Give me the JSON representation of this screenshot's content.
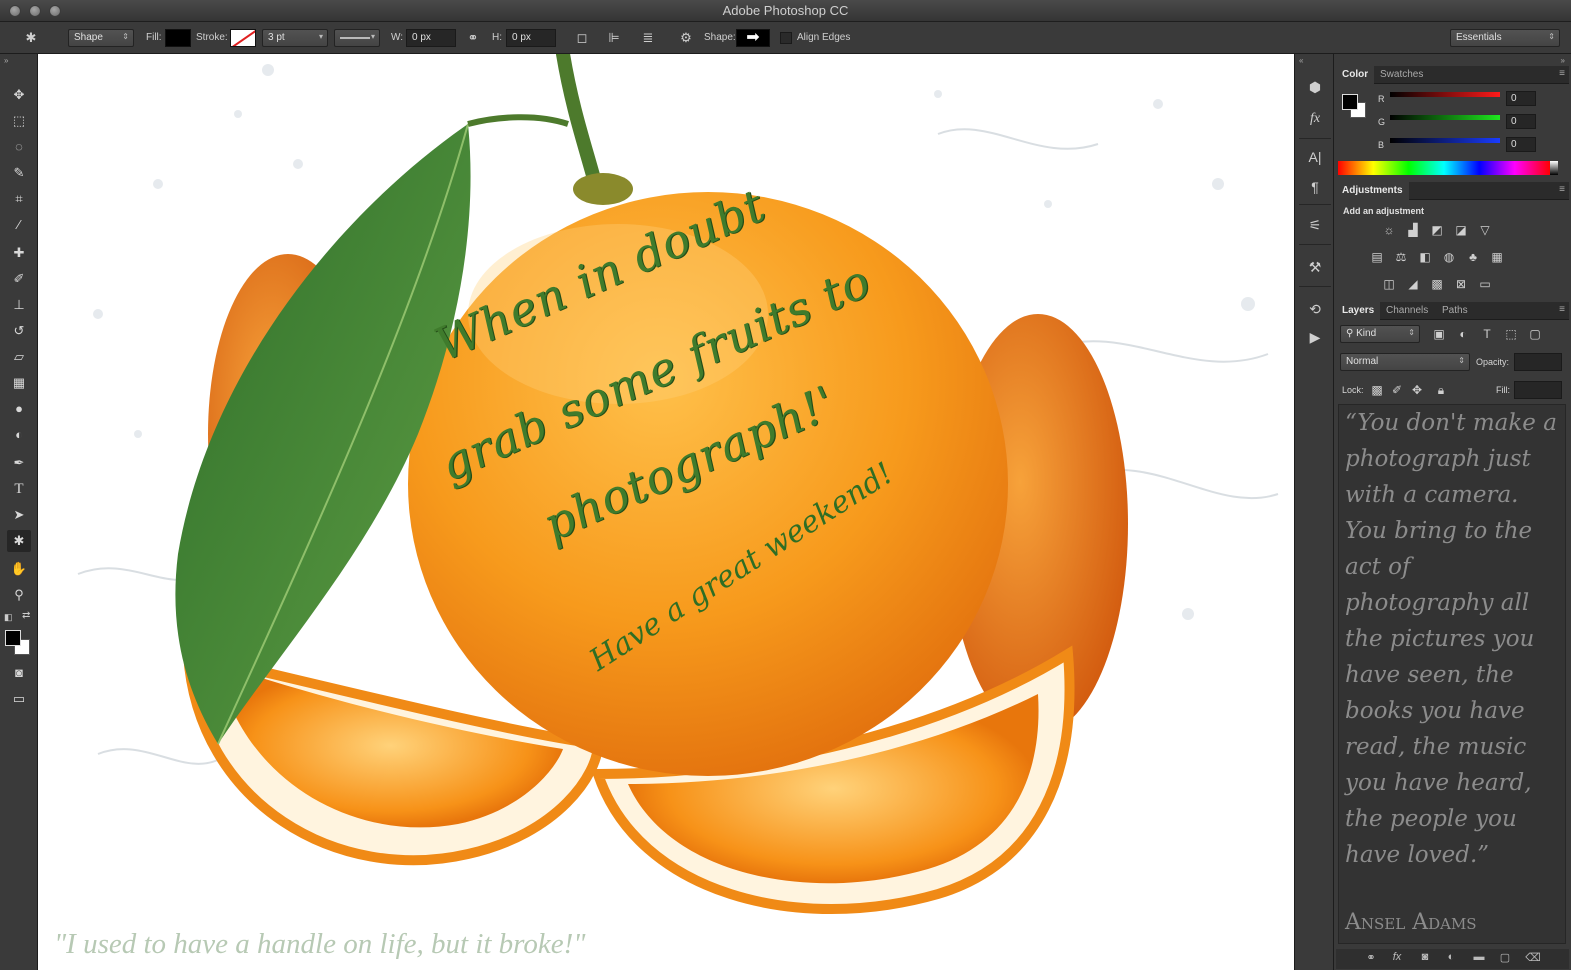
{
  "app": {
    "title": "Adobe Photoshop CC"
  },
  "options_bar": {
    "tool_mode": "Shape",
    "fill_label": "Fill:",
    "stroke_label": "Stroke:",
    "stroke_width": "3 pt",
    "w_label": "W:",
    "w_value": "0 px",
    "h_label": "H:",
    "h_value": "0 px",
    "shape_label": "Shape:",
    "align_edges_label": "Align Edges",
    "workspace": "Essentials"
  },
  "canvas": {
    "headline_line1": "When in doubt",
    "headline_line2": "grab some fruits to",
    "headline_line3": "photograph!'",
    "weekend_text": "Have a great weekend!",
    "bottom_quote": "\"I used to have a handle on life, but it broke!\""
  },
  "color_panel": {
    "tabs": [
      "Color",
      "Swatches"
    ],
    "r_label": "R",
    "g_label": "G",
    "b_label": "B",
    "r_value": "0",
    "g_value": "0",
    "b_value": "0"
  },
  "adjustments_panel": {
    "tab": "Adjustments",
    "heading": "Add an adjustment"
  },
  "layers_panel": {
    "tabs": [
      "Layers",
      "Channels",
      "Paths"
    ],
    "filter": "Kind",
    "blend_mode": "Normal",
    "opacity_label": "Opacity:",
    "lock_label": "Lock:",
    "fill_label": "Fill:"
  },
  "quote_panel": {
    "text": "“You don't make a photograph just with a camera. You bring to the act of photography all the pictures you have seen, the books you have read, the music you have heard, the people you have loved.”",
    "author": "Ansel Adams"
  },
  "colors": {
    "orange": "#f5961c",
    "leaf": "#4a8a3c",
    "text_green": "#3f7b2c",
    "ui_bg": "#3a3a3a"
  }
}
